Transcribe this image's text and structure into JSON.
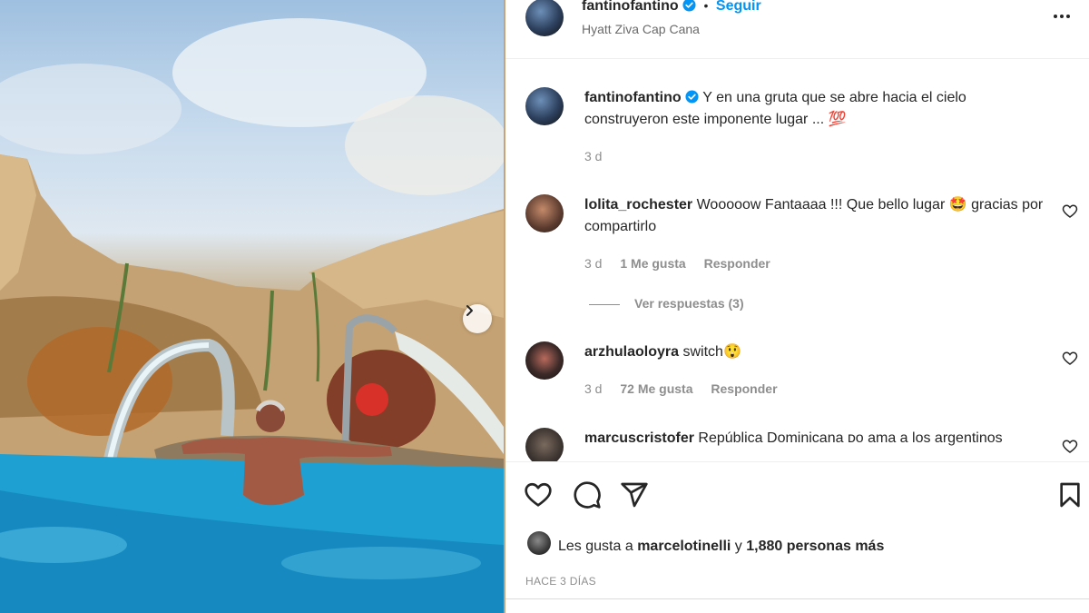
{
  "post": {
    "username": "fantinofantino",
    "separator": "•",
    "follow_label": "Seguir",
    "location": "Hyatt Ziva Cap Cana"
  },
  "caption": {
    "username": "fantinofantino",
    "text": "Y en una gruta que se abre hacia el cielo construyeron este imponente lugar ...",
    "emoji": "💯",
    "time": "3 d"
  },
  "comments": [
    {
      "username": "lolita_rochester",
      "text": "Wooooow Fantaaaa !!! Que bello lugar 🤩 gracias por compartirlo",
      "time": "3 d",
      "likes": "1 Me gusta",
      "reply_label": "Responder",
      "view_replies": "Ver respuestas (3)"
    },
    {
      "username": "arzhulaoloyra",
      "text": "switch😲",
      "time": "3 d",
      "likes": "72 Me gusta",
      "reply_label": "Responder"
    },
    {
      "username": "marcuscristofer",
      "text": "República Dominicana ᴅo ama a los argentinos"
    }
  ],
  "likes": {
    "prefix": "Les gusta a",
    "user": "marcelotinelli",
    "connector": "y",
    "others": "1,880 personas más"
  },
  "timestamp": "HACE 3 DÍAS",
  "icons": [
    "verified-icon",
    "more-options-icon",
    "heart-icon",
    "comment-icon",
    "share-icon",
    "bookmark-icon",
    "chevron-right-icon"
  ]
}
